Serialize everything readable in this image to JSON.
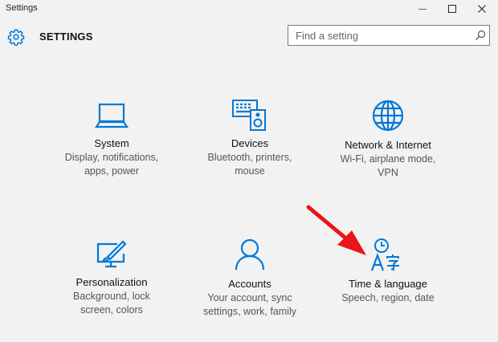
{
  "window": {
    "title": "Settings",
    "controls": {
      "minimize": "—",
      "maximize": "☐",
      "close": "✕"
    }
  },
  "header": {
    "title": "SETTINGS",
    "icon": "gear-icon",
    "search_placeholder": "Find a setting",
    "search_icon": "search-icon"
  },
  "accent_color": "#0078d7",
  "annotation_arrow_color": "#e8151b",
  "tiles": [
    {
      "label": "System",
      "desc": [
        "Display, notifications,",
        "apps, power"
      ],
      "icon": "laptop-icon"
    },
    {
      "label": "Devices",
      "desc": [
        "Bluetooth, printers,",
        "mouse"
      ],
      "icon": "devices-icon"
    },
    {
      "label": "Network & Internet",
      "desc": [
        "Wi-Fi, airplane mode,",
        "VPN"
      ],
      "icon": "globe-icon"
    },
    {
      "label": "Personalization",
      "desc": [
        "Background, lock",
        "screen, colors"
      ],
      "icon": "personalization-icon"
    },
    {
      "label": "Accounts",
      "desc": [
        "Your account, sync",
        "settings, work, family"
      ],
      "icon": "person-icon"
    },
    {
      "label": "Time & language",
      "desc": [
        "Speech, region, date"
      ],
      "icon": "time-language-icon"
    }
  ]
}
